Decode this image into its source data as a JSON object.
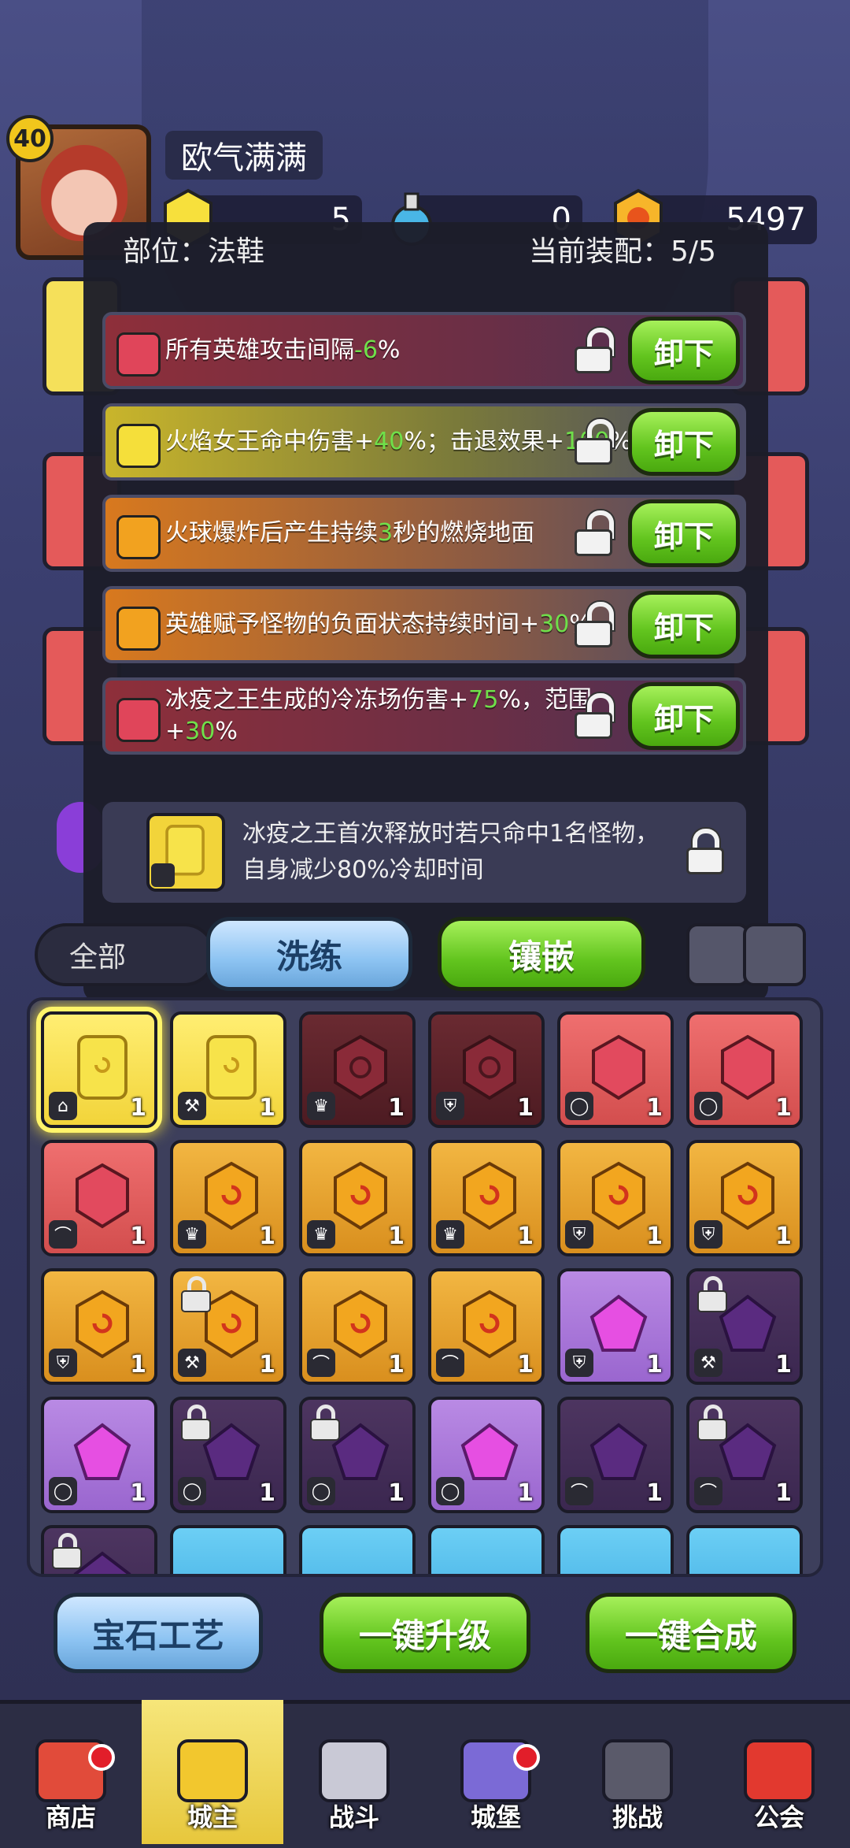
{
  "player": {
    "level": "40",
    "name": "欧气满满",
    "resources": [
      {
        "icon": "yellow-gem-icon",
        "value": "5"
      },
      {
        "icon": "potion-icon",
        "value": "0"
      },
      {
        "icon": "gold-coin-icon",
        "value": "5497"
      }
    ]
  },
  "modal": {
    "slot_label": "部位：法鞋",
    "equip_label": "当前装配：5/5",
    "unequip_label": "卸下",
    "rows": [
      {
        "gem": "red",
        "text_parts": [
          "所有英雄攻击间隔",
          "-6",
          "%"
        ]
      },
      {
        "gem": "yellow",
        "text_parts": [
          "火焰女王命中伤害+",
          "40",
          "%；击退效果+",
          "100",
          "%"
        ]
      },
      {
        "gem": "orange",
        "text_parts": [
          "火球爆炸后产生持续",
          "3",
          "秒的燃烧地面"
        ]
      },
      {
        "gem": "orange",
        "text_parts": [
          "英雄赋予怪物的负面状态持续时间+",
          "30",
          "%"
        ]
      },
      {
        "gem": "red",
        "text_parts": [
          "冰疫之王生成的冷冻场伤害+",
          "75",
          "%，范围+",
          "30",
          "%"
        ]
      }
    ],
    "set_text": "冰疫之王首次释放时若只命中1名怪物，自身减少80%冷却时间",
    "refine_label": "洗练",
    "inlay_label": "镶嵌"
  },
  "filter": {
    "label": "全部"
  },
  "inventory": [
    {
      "color": "yellow",
      "slot": "boot",
      "count": "1",
      "locked": false
    },
    {
      "color": "yellow",
      "slot": "staff",
      "count": "1",
      "locked": false
    },
    {
      "color": "dred",
      "slot": "crown",
      "count": "1",
      "locked": false
    },
    {
      "color": "dred",
      "slot": "armor",
      "count": "1",
      "locked": false
    },
    {
      "color": "red",
      "slot": "ring",
      "count": "1",
      "locked": false
    },
    {
      "color": "red",
      "slot": "ring",
      "count": "1",
      "locked": false
    },
    {
      "color": "red",
      "slot": "cape",
      "count": "1",
      "locked": false
    },
    {
      "color": "orange",
      "slot": "crown",
      "count": "1",
      "locked": false
    },
    {
      "color": "orange",
      "slot": "crown",
      "count": "1",
      "locked": false
    },
    {
      "color": "orange",
      "slot": "crown",
      "count": "1",
      "locked": false
    },
    {
      "color": "orange",
      "slot": "armor",
      "count": "1",
      "locked": false
    },
    {
      "color": "orange",
      "slot": "armor",
      "count": "1",
      "locked": false
    },
    {
      "color": "orange",
      "slot": "armor",
      "count": "1",
      "locked": false
    },
    {
      "color": "orange",
      "slot": "staff",
      "count": "1",
      "locked": true
    },
    {
      "color": "orange",
      "slot": "cape",
      "count": "1",
      "locked": false
    },
    {
      "color": "orange",
      "slot": "cape",
      "count": "1",
      "locked": false
    },
    {
      "color": "purple",
      "slot": "armor",
      "count": "1",
      "locked": false
    },
    {
      "color": "dpurple",
      "slot": "staff",
      "count": "1",
      "locked": true
    },
    {
      "color": "purple",
      "slot": "ring",
      "count": "1",
      "locked": false
    },
    {
      "color": "dpurple",
      "slot": "ring",
      "count": "1",
      "locked": true
    },
    {
      "color": "dpurple",
      "slot": "ring",
      "count": "1",
      "locked": true
    },
    {
      "color": "purple",
      "slot": "ring",
      "count": "1",
      "locked": false
    },
    {
      "color": "dpurple",
      "slot": "cape",
      "count": "1",
      "locked": false
    },
    {
      "color": "dpurple",
      "slot": "cape",
      "count": "1",
      "locked": true
    },
    {
      "color": "dpurple",
      "slot": "",
      "count": "",
      "locked": true
    },
    {
      "color": "blue",
      "slot": "",
      "count": "",
      "locked": false
    },
    {
      "color": "blue",
      "slot": "",
      "count": "",
      "locked": false
    },
    {
      "color": "blue",
      "slot": "",
      "count": "",
      "locked": false
    },
    {
      "color": "blue",
      "slot": "",
      "count": "",
      "locked": false
    },
    {
      "color": "blue",
      "slot": "",
      "count": "",
      "locked": false
    }
  ],
  "actions": {
    "gem_craft": "宝石工艺",
    "upgrade_all": "一键升级",
    "merge_all": "一键合成"
  },
  "tabs": [
    {
      "label": "商店",
      "icon": "shop-icon",
      "badge": true
    },
    {
      "label": "城主",
      "icon": "crown-icon",
      "badge": false,
      "active": true
    },
    {
      "label": "战斗",
      "icon": "swords-icon",
      "badge": false
    },
    {
      "label": "城堡",
      "icon": "castle-icon",
      "badge": true
    },
    {
      "label": "挑战",
      "icon": "demon-icon",
      "badge": false
    },
    {
      "label": "公会",
      "icon": "banner-icon",
      "badge": false
    }
  ],
  "colors": {
    "green_value": "#6fe04a",
    "accent_yellow": "#f6e67a"
  }
}
